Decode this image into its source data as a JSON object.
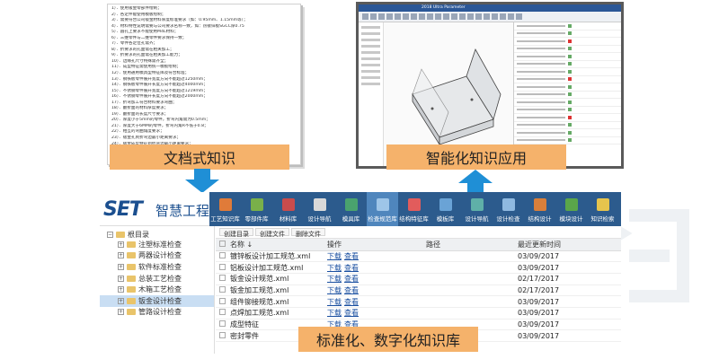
{
  "labels": {
    "document": "文档式知识",
    "application": "智能化知识应用",
    "library": "标准化、数字化知识库"
  },
  "document": {
    "lines": [
      "1）．使用钣金零部件绘制；",
      "2）．各定件能使用模板绘制；",
      "3）．需要符合公司钣金材料厚度标准要求（如：0.95mm、1.15mm等）；",
      "4）．材料特性说明需要与公司要求名称一致，如：热镀锌板SGCC厚0.75",
      "5）．圆孔上要求不能使用M4L材料；",
      "6）．三维零件与二维零件要求保持一致；",
      "7）．零件各定位孔需齐；",
      "8）．折要求的孔面需在相关加工；",
      "9）．折要求的孔面需在相关加工能力；",
      "10）．边缘孔尺寸特殊需齐全；",
      "11）．成型特征需使用统一模板绘制；",
      "12）．使用通用模具型特征库及符合标准；",
      "13）．钢铁板零件展开宽度方向不能超过1250mm；",
      "14）．钢铁板零件展开长度方向不能超过4000mm；",
      "15）．不锈钢零件展开宽度方向不能超过1219mm；",
      "16）．不锈钢零件展开长度方向不能超过2000mm；",
      "17）．折弯加工符合材料要求弯曲；",
      "18）．翻折面的材料厚度要求；",
      "19）．翻折面的长度尺寸要求；",
      "20）．厚度小于5mm的零件，折弯内角需为0.5mm；",
      "21）．厚度大于6MM的零件，折弯内角R不低于0.8；",
      "22）．相互的弯曲角度要求；",
      "23）．钣金孔到折弯边最小距离要求；",
      "24）．钣金成型特征到折弯边最小距离要求；"
    ]
  },
  "cad": {
    "title": "2018 Ultra Parameter"
  },
  "app": {
    "logo": "SET",
    "brand": "智慧工程",
    "menu": [
      {
        "label": "工艺知识库",
        "icon": "process-icon",
        "color": "#e07b39",
        "active": false
      },
      {
        "label": "零部件库",
        "icon": "parts-icon",
        "color": "#79b04a",
        "active": false
      },
      {
        "label": "材料库",
        "icon": "material-icon",
        "color": "#c94c4c",
        "active": false
      },
      {
        "label": "设计导航",
        "icon": "navigation-icon",
        "color": "#d9d9d9",
        "active": false
      },
      {
        "label": "模具库",
        "icon": "mold-icon",
        "color": "#4aa36e",
        "active": false
      },
      {
        "label": "检查规范库",
        "icon": "inspection-icon",
        "color": "#9ec5e8",
        "active": true
      },
      {
        "label": "结构特征库",
        "icon": "structure-icon",
        "color": "#e25c5c",
        "active": false
      },
      {
        "label": "模板库",
        "icon": "template-icon",
        "color": "#6aa3d6",
        "active": false
      },
      {
        "label": "设计导航",
        "icon": "navigation2-icon",
        "color": "#5fb0a8",
        "active": false
      },
      {
        "label": "设计检查",
        "icon": "design-check-icon",
        "color": "#8fb9e0",
        "active": false
      },
      {
        "label": "结构设计",
        "icon": "structure-design-icon",
        "color": "#d97f3a",
        "active": false
      },
      {
        "label": "模块设计",
        "icon": "module-icon",
        "color": "#5aa64a",
        "active": false
      },
      {
        "label": "知识检索",
        "icon": "search-icon",
        "color": "#e6c44d",
        "active": false
      }
    ],
    "tree": {
      "root": "根目录",
      "items": [
        {
          "label": "注塑标准检查",
          "selected": false
        },
        {
          "label": "两器设计检查",
          "selected": false
        },
        {
          "label": "软件标准检查",
          "selected": false
        },
        {
          "label": "总装工艺检查",
          "selected": false
        },
        {
          "label": "木箱工艺检查",
          "selected": false
        },
        {
          "label": "钣金设计检查",
          "selected": true
        },
        {
          "label": "管路设计检查",
          "selected": false
        }
      ]
    },
    "actions": [
      "创建目录",
      "创建文件",
      "删除文件"
    ],
    "columns": {
      "name": "名称 ↓",
      "op": "操作",
      "path": "路径",
      "updated": "最近更新时间"
    },
    "op_labels": {
      "download": "下载",
      "view": "查看"
    },
    "rows": [
      {
        "name": "镀锌板设计加工规范.xml",
        "date": "03/09/2017"
      },
      {
        "name": "铝板设计加工规范.xml",
        "date": "03/09/2017"
      },
      {
        "name": "钣金设计规范.xml",
        "date": "02/17/2017"
      },
      {
        "name": "钣金加工规范.xml",
        "date": "02/17/2017"
      },
      {
        "name": "组件铆接规范.xml",
        "date": "03/09/2017"
      },
      {
        "name": "点焊加工规范.xml",
        "date": "03/09/2017"
      },
      {
        "name": "成型特征",
        "date": "03/09/2017"
      },
      {
        "name": "密封零件",
        "date": "03/09/2017"
      }
    ]
  }
}
